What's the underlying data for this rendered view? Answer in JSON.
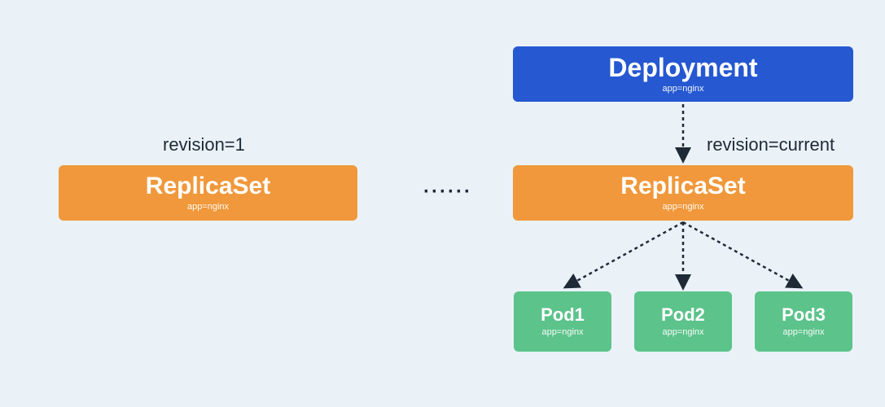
{
  "colors": {
    "background": "#eaf2f7",
    "deployment": "#2558d1",
    "replicaset": "#f0983b",
    "pod": "#5cc38b",
    "text": "#1f2a37"
  },
  "deployment": {
    "title": "Deployment",
    "sub": "app=nginx"
  },
  "replicaset_left": {
    "title": "ReplicaSet",
    "sub": "app=nginx",
    "revision_label": "revision=1"
  },
  "replicaset_right": {
    "title": "ReplicaSet",
    "sub": "app=nginx",
    "revision_label": "revision=current"
  },
  "ellipsis": "······",
  "pods": [
    {
      "title": "Pod1",
      "sub": "app=nginx"
    },
    {
      "title": "Pod2",
      "sub": "app=nginx"
    },
    {
      "title": "Pod3",
      "sub": "app=nginx"
    }
  ]
}
